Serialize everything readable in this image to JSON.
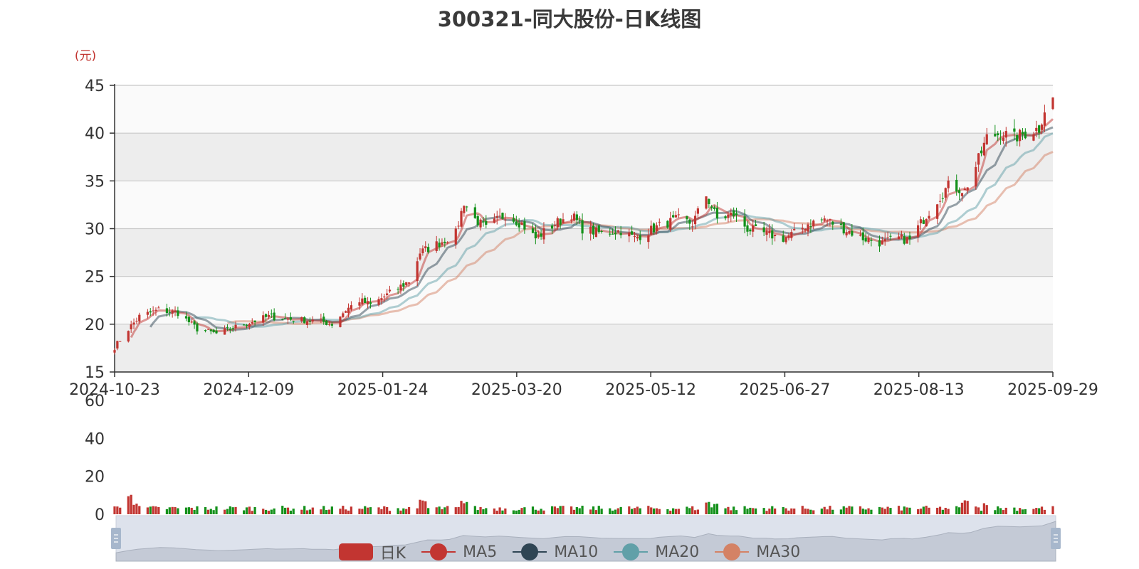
{
  "title": "300321-同大股份-日K线图",
  "colors": {
    "up": "#c23531",
    "down": "#14911b",
    "ma5": "#c23531",
    "ma10": "#2f4554",
    "ma20": "#61a0a8",
    "ma30": "#d48265"
  },
  "legend": [
    {
      "name": "日K",
      "icon": "roundrect",
      "color": "#c23531"
    },
    {
      "name": "MA5",
      "icon": "circle",
      "color": "#c23531"
    },
    {
      "name": "MA10",
      "icon": "circle",
      "color": "#2f4554"
    },
    {
      "name": "MA20",
      "icon": "circle",
      "color": "#61a0a8"
    },
    {
      "name": "MA30",
      "icon": "circle",
      "color": "#d48265"
    }
  ],
  "chart_data": {
    "type": "candlestick",
    "unit_label": "(元)",
    "ylim": [
      15,
      45
    ],
    "yticks": [
      15,
      20,
      25,
      30,
      35,
      40,
      45
    ],
    "volume_ylim": [
      0,
      60
    ],
    "volume_yticks": [
      0,
      20,
      40,
      60
    ],
    "xticks": [
      "2024-10-23",
      "2024-12-09",
      "2025-01-24",
      "2025-03-20",
      "2025-05-12",
      "2025-06-27",
      "2025-08-13",
      "2025-09-29"
    ],
    "x_start": "2024-10-23",
    "x_end": "2025-09-29",
    "price_anchors": [
      [
        "2024-10-23",
        17.6
      ],
      [
        "2024-10-28",
        19.5
      ],
      [
        "2024-11-01",
        20.8
      ],
      [
        "2024-11-08",
        21.5
      ],
      [
        "2024-11-15",
        21.2
      ],
      [
        "2024-11-22",
        19.5
      ],
      [
        "2024-11-29",
        19.0
      ],
      [
        "2024-12-09",
        20.0
      ],
      [
        "2024-12-18",
        20.8
      ],
      [
        "2024-12-27",
        20.5
      ],
      [
        "2025-01-06",
        20.3
      ],
      [
        "2025-01-10",
        20.0
      ],
      [
        "2025-01-15",
        21.5
      ],
      [
        "2025-01-20",
        22.5
      ],
      [
        "2025-01-24",
        22.0
      ],
      [
        "2025-02-07",
        24.5
      ],
      [
        "2025-02-11",
        27.5
      ],
      [
        "2025-02-18",
        28.5
      ],
      [
        "2025-02-24",
        29.5
      ],
      [
        "2025-02-27",
        32.8
      ],
      [
        "2025-03-03",
        31.0
      ],
      [
        "2025-03-07",
        30.0
      ],
      [
        "2025-03-14",
        31.5
      ],
      [
        "2025-03-20",
        30.5
      ],
      [
        "2025-03-25",
        29.0
      ],
      [
        "2025-04-01",
        30.5
      ],
      [
        "2025-04-07",
        31.5
      ],
      [
        "2025-04-11",
        30.0
      ],
      [
        "2025-04-18",
        29.5
      ],
      [
        "2025-04-25",
        29.8
      ],
      [
        "2025-04-30",
        29.0
      ],
      [
        "2025-05-09",
        30.3
      ],
      [
        "2025-05-16",
        31.0
      ],
      [
        "2025-05-21",
        30.5
      ],
      [
        "2025-05-26",
        33.5
      ],
      [
        "2025-05-30",
        31.0
      ],
      [
        "2025-06-05",
        31.5
      ],
      [
        "2025-06-10",
        30.0
      ],
      [
        "2025-06-16",
        29.5
      ],
      [
        "2025-06-23",
        29.0
      ],
      [
        "2025-06-27",
        29.5
      ],
      [
        "2025-07-02",
        30.5
      ],
      [
        "2025-07-08",
        31.0
      ],
      [
        "2025-07-15",
        30.0
      ],
      [
        "2025-07-22",
        29.0
      ],
      [
        "2025-07-29",
        28.5
      ],
      [
        "2025-08-04",
        29.0
      ],
      [
        "2025-08-08",
        28.8
      ],
      [
        "2025-08-13",
        31.0
      ],
      [
        "2025-08-18",
        33.0
      ],
      [
        "2025-08-22",
        34.5
      ],
      [
        "2025-08-28",
        34.0
      ],
      [
        "2025-09-01",
        36.5
      ],
      [
        "2025-09-05",
        39.5
      ],
      [
        "2025-09-10",
        40.0
      ],
      [
        "2025-09-15",
        39.5
      ],
      [
        "2025-09-19",
        40.0
      ],
      [
        "2025-09-24",
        40.5
      ],
      [
        "2025-09-26",
        42.5
      ],
      [
        "2025-09-29",
        43.5
      ]
    ],
    "volume_scale": 60,
    "volume_level": 3.0,
    "volume_spikes": [
      [
        "2024-10-28",
        10
      ],
      [
        "2024-10-30",
        6
      ],
      [
        "2025-02-27",
        7
      ],
      [
        "2025-02-12",
        7
      ],
      [
        "2025-05-26",
        7
      ],
      [
        "2025-05-30",
        6
      ],
      [
        "2025-08-28",
        7
      ],
      [
        "2025-09-05",
        6
      ]
    ]
  }
}
